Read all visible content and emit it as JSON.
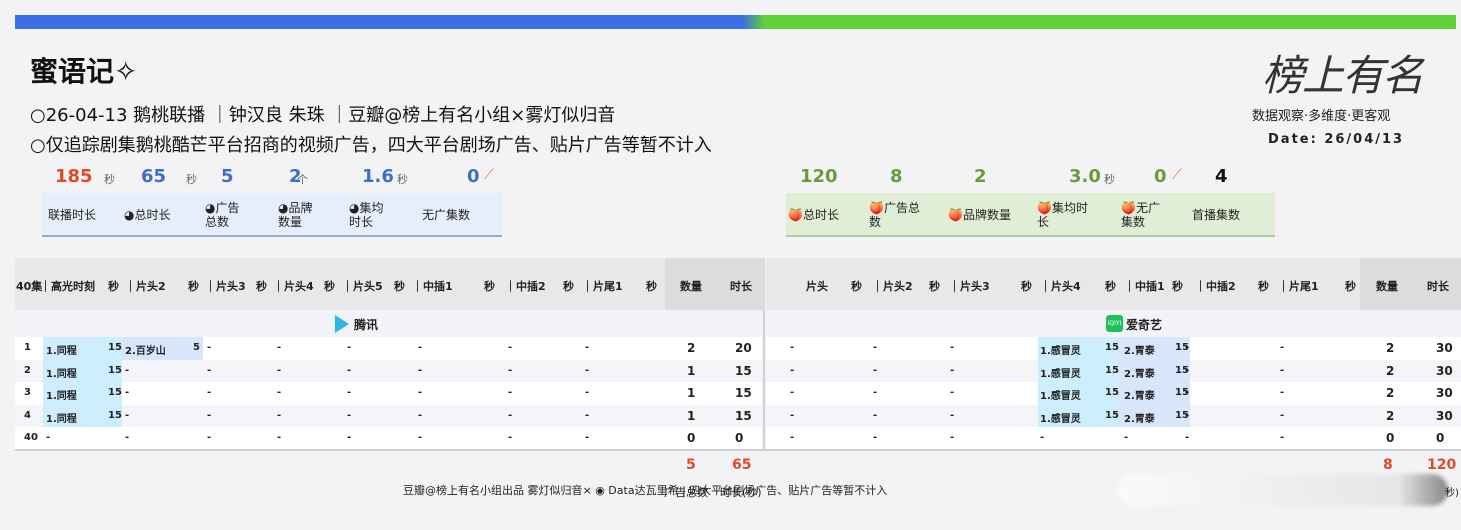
{
  "header": {
    "title": "蜜语记✧",
    "line1": "26-04-13 鹅桃联播 ｜钟汉良 朱珠 ｜豆瓣@榜上有名小组×雾灯似归音",
    "line2": "仅追踪剧集鹅桃酷芒平台招商的视频广告，四大平台剧场广告、贴片广告等暂不计入"
  },
  "logo": {
    "text": "榜上有名",
    "slogan": "数据观察·多维度·更客观",
    "date": "Date: 26/04/13"
  },
  "left_stats": {
    "values": [
      "185",
      "65",
      "5",
      "2",
      "1.6",
      "0"
    ],
    "units": [
      "秒",
      "秒",
      "",
      "个",
      "秒",
      ""
    ],
    "labels": [
      "联播时长",
      "总时长",
      "广告\n总数",
      "品牌\n数量",
      "集均\n时长",
      "无广集数"
    ]
  },
  "right_stats": {
    "values": [
      "120",
      "8",
      "2",
      "3.0",
      "0",
      "4"
    ],
    "units": [
      "",
      "",
      "",
      "秒",
      "",
      ""
    ],
    "labels": [
      "总时长",
      "广告总\n数",
      "品牌数量",
      "集均时\n长",
      "无广\n集数",
      "首播集数"
    ]
  },
  "left_table": {
    "platform": "腾讯",
    "headers": [
      "40集",
      "｜高光时刻",
      "秒",
      "｜片头2",
      "秒",
      "｜片头3",
      "秒",
      "｜片头4",
      "秒",
      "｜片头5",
      "秒",
      "｜中插1",
      "秒",
      "｜中插2",
      "秒",
      "｜片尾1",
      "秒",
      "数量",
      "时长"
    ],
    "rows": [
      [
        "1",
        "1.同程",
        "15",
        "2.百岁山",
        "5",
        "-",
        "",
        "-",
        "",
        "-",
        "",
        "-",
        "",
        "-",
        "",
        "-",
        "",
        "2",
        "20"
      ],
      [
        "2",
        "1.同程",
        "15",
        "-",
        "",
        "-",
        "",
        "-",
        "",
        "-",
        "",
        "-",
        "",
        "-",
        "",
        "-",
        "",
        "1",
        "15"
      ],
      [
        "3",
        "1.同程",
        "15",
        "-",
        "",
        "-",
        "",
        "-",
        "",
        "-",
        "",
        "-",
        "",
        "-",
        "",
        "-",
        "",
        "1",
        "15"
      ],
      [
        "4",
        "1.同程",
        "15",
        "-",
        "",
        "-",
        "",
        "-",
        "",
        "-",
        "",
        "-",
        "",
        "-",
        "",
        "-",
        "",
        "1",
        "15"
      ],
      [
        "40",
        "-",
        "",
        "-",
        "",
        "-",
        "",
        "-",
        "",
        "-",
        "",
        "-",
        "",
        "-",
        "",
        "-",
        "",
        "0",
        "0"
      ]
    ],
    "totals": [
      "5",
      "65"
    ]
  },
  "right_table": {
    "platform": "爱奇艺",
    "platform_icon_text": "iQIYI",
    "headers": [
      "片头",
      "秒",
      "｜片头2",
      "秒",
      "｜片头3",
      "秒",
      "｜片头4",
      "秒",
      "｜中插1",
      "秒",
      "｜中插2",
      "秒",
      "｜片尾1",
      "秒",
      "数量",
      "时长"
    ],
    "rows": [
      [
        "-",
        "",
        "-",
        "",
        "-",
        "",
        "1.感冒灵",
        "15",
        "2.胃泰",
        "15",
        "-",
        "",
        "-",
        "",
        "2",
        "30"
      ],
      [
        "-",
        "",
        "-",
        "",
        "-",
        "",
        "1.感冒灵",
        "15",
        "2.胃泰",
        "15",
        "-",
        "",
        "-",
        "",
        "2",
        "30"
      ],
      [
        "-",
        "",
        "-",
        "",
        "-",
        "",
        "1.感冒灵",
        "15",
        "2.胃泰",
        "15",
        "-",
        "",
        "-",
        "",
        "2",
        "30"
      ],
      [
        "-",
        "",
        "-",
        "",
        "-",
        "",
        "1.感冒灵",
        "15",
        "2.胃泰",
        "15",
        "-",
        "",
        "-",
        "",
        "2",
        "30"
      ],
      [
        "-",
        "",
        "-",
        "",
        "-",
        "",
        "-",
        "",
        "-",
        "",
        "-",
        "",
        "-",
        "",
        "0",
        "0"
      ]
    ],
    "totals": [
      "8",
      "120"
    ]
  },
  "footer": {
    "credit": "豆瓣@榜上有名小组出品 雾灯似归音× ◉ Data达瓦里希 | 四大平台剧场广告、贴片广告等暂不计入",
    "count_label": "广告总数",
    "dur_label": "时长(秒)",
    "trailing": "秒)"
  },
  "colors": {
    "accent_red": "#e04a2a",
    "blue": "#3d6fc4",
    "green": "#6a9a3a"
  }
}
